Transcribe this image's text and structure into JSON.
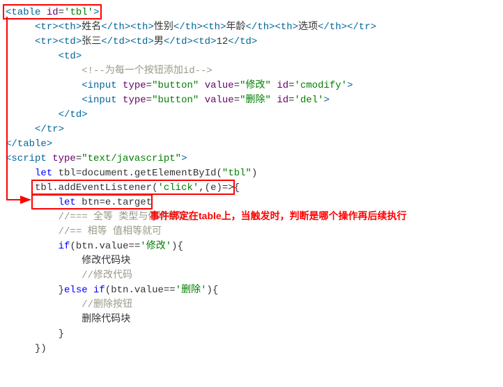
{
  "code": {
    "l1": {
      "open": "<",
      "tag": "table",
      "sp": " ",
      "attr": "id",
      "eq": "=",
      "val": "'tbl'",
      "close": ">"
    },
    "l2": {
      "open": "<",
      "tr": "tr",
      "close": ">",
      "th": "th",
      "h1": "姓名",
      "h2": "性别",
      "h3": "年龄",
      "h4": "选项",
      "ctr": "</tr>"
    },
    "l3": {
      "open": "<",
      "tr": "tr",
      "close": ">",
      "td": "td",
      "v1": "张三",
      "v2": "男",
      "v3": "12"
    },
    "l4": {
      "open": "<",
      "td": "td",
      "close": ">"
    },
    "l5": {
      "text": "<!--为每一个按钮添加id-->"
    },
    "l6": {
      "open": "<",
      "tag": "input",
      "sp": " ",
      "a1": "type",
      "v1": "\"button\"",
      "a2": "value",
      "v2": "\"修改\"",
      "a3": "id",
      "v3": "'cmodify'",
      "close": ">"
    },
    "l7": {
      "open": "<",
      "tag": "input",
      "sp": " ",
      "a1": "type",
      "v1": "\"button\"",
      "a2": "value",
      "v2": "\"删除\"",
      "a3": "id",
      "v3": "'del'",
      "close": ">"
    },
    "l8": {
      "open": "</",
      "td": "td",
      "close": ">"
    },
    "l9": {
      "open": "</",
      "tr": "tr",
      "close": ">"
    },
    "l10": {
      "open": "</",
      "table": "table",
      "close": ">"
    },
    "l11": {
      "open": "<",
      "tag": "script",
      "sp": " ",
      "attr": "type",
      "eq": "=",
      "val": "\"text/javascript\"",
      "close": ">"
    },
    "l12": {
      "kw": "let",
      "sp": " ",
      "id1": "tbl",
      "eq": "=",
      "id2": "document",
      "dot": ".",
      "fn": "getElementById",
      "paren": "(",
      "str": "\"tbl\"",
      "cparen": ")"
    },
    "l13": {
      "id": "tbl",
      "dot": ".",
      "fn": "addEventListener",
      "paren": "(",
      "str": "'click'",
      "comma": ",",
      "arrow": "(e)=>",
      "brace": "{"
    },
    "l14": {
      "kw": "let",
      "sp": " ",
      "id1": "btn",
      "eq": "=",
      "id2": "e",
      "dot": ".",
      "prop": "target"
    },
    "l15": {
      "text": "//=== 全等 类型与值均相等；"
    },
    "l16": {
      "text": "//== 相等 值相等就可"
    },
    "l17": {
      "kw": "if",
      "paren": "(",
      "id": "btn",
      "dot": ".",
      "prop": "value",
      "eq": "==",
      "str": "'修改'",
      "cparen": ")",
      "brace": "{"
    },
    "l18": {
      "text": "修改代码块"
    },
    "l19": {
      "text": "//修改代码"
    },
    "l20": {
      "cbrace": "}",
      "kw": "else if",
      "paren": "(",
      "id": "btn",
      "dot": ".",
      "prop": "value",
      "eq": "==",
      "str": "'删除'",
      "cparen": ")",
      "brace": "{"
    },
    "l21": {
      "text": "//删除按钮"
    },
    "l22": {
      "text": "删除代码块"
    },
    "l23": {
      "cbrace": "}"
    },
    "l24": {
      "cbrace": "})"
    }
  },
  "annotation": {
    "text": "事件绑定在table上，当触发时，判断是哪个操作再后续执行"
  }
}
